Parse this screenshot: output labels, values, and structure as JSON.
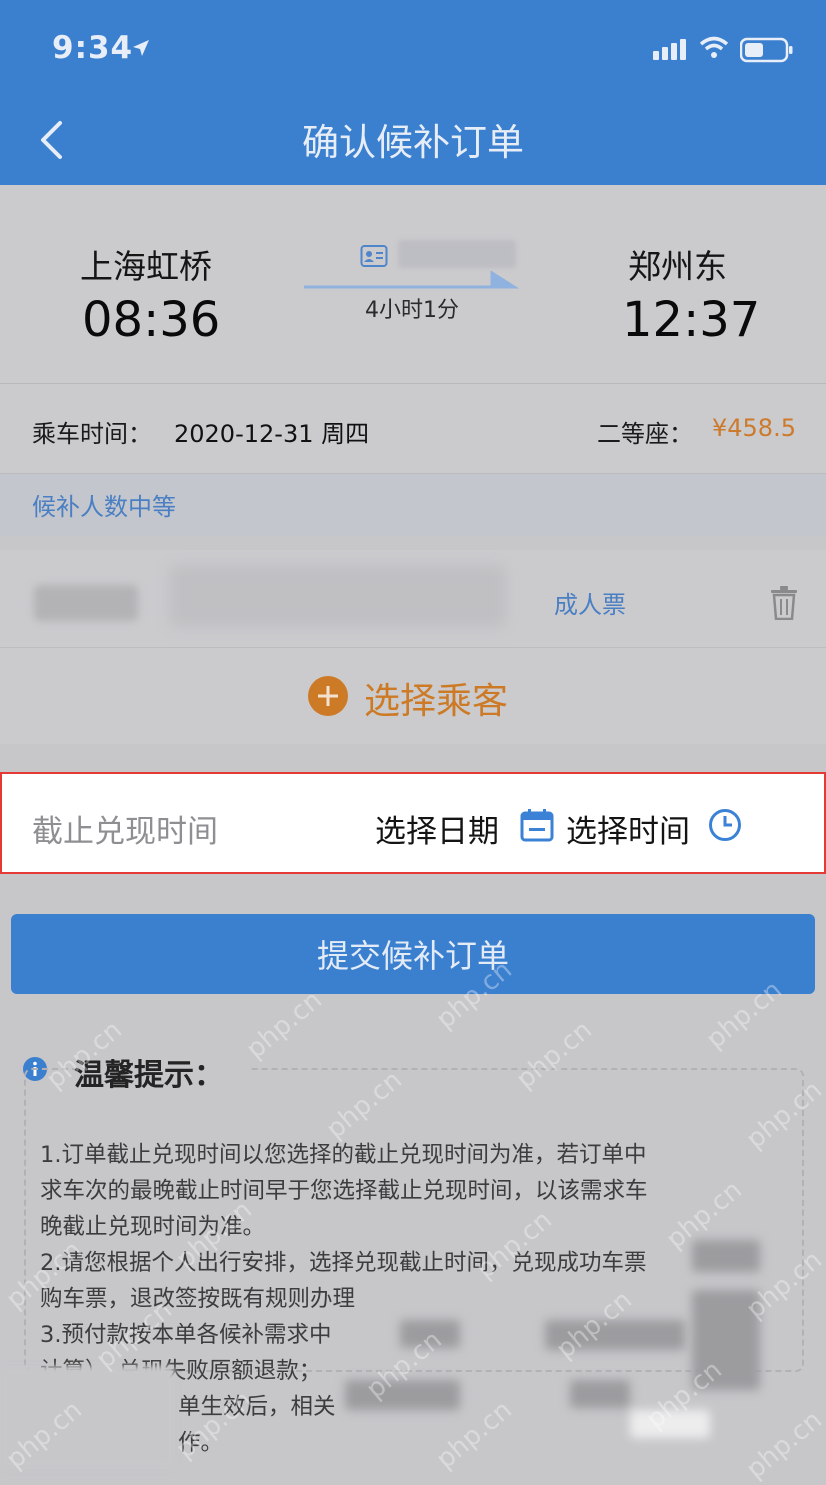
{
  "status_bar": {
    "time": "9:34"
  },
  "header": {
    "title": "确认候补订单"
  },
  "train": {
    "from_station": "上海虹桥",
    "from_time": "08:36",
    "to_station": "郑州东",
    "to_time": "12:37",
    "duration": "4小时1分"
  },
  "trip": {
    "date_label": "乘车时间：",
    "date_value": "2020-12-31 周四",
    "seat_label": "二等座：",
    "price": "¥458.5"
  },
  "queue_status": "候补人数中等",
  "passenger": {
    "ticket_type": "成人票"
  },
  "add_passenger_label": "选择乘客",
  "deadline": {
    "label": "截止兑现时间",
    "choose_date": "选择日期",
    "choose_time": "选择时间"
  },
  "submit_label": "提交候补订单",
  "tips": {
    "title": "温馨提示：",
    "lines": [
      "1.订单截止兑现时间以您选择的截止兑现时间为准，若订单中",
      "求车次的最晚截止时间早于您选择截止兑现时间，以该需求车",
      "晚截止兑现时间为准。",
      "2.请您根据个人出行安排，选择兑现截止时间，兑现成功车票",
      "购车票，退改签按既有规则办理",
      "3.预付款按本单各候补需求中",
      "计算），兑现失败原额退款；",
      "单生效后，相关",
      "作。"
    ]
  },
  "watermark": "php.cn",
  "colors": {
    "brand_blue": "#3b7fcf",
    "accent_orange": "#cd7a26",
    "link_blue": "#4a7fc3",
    "highlight_red": "#e33a36"
  }
}
